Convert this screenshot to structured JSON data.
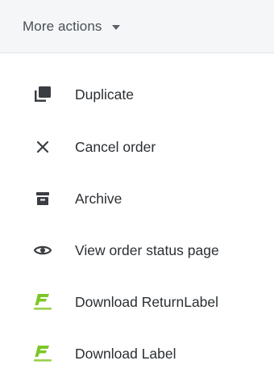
{
  "trigger": {
    "label": "More actions",
    "icon": "chevron-down-icon"
  },
  "menu": {
    "items": [
      {
        "label": "Duplicate",
        "icon": "duplicate-icon"
      },
      {
        "label": "Cancel order",
        "icon": "close-icon"
      },
      {
        "label": "Archive",
        "icon": "archive-icon"
      },
      {
        "label": "View order status page",
        "icon": "eye-icon"
      },
      {
        "label": "Download ReturnLabel",
        "icon": "app-logo-icon"
      },
      {
        "label": "Download Label",
        "icon": "app-logo-icon"
      }
    ]
  },
  "colors": {
    "trigger_bg": "#f4f6f8",
    "text": "#2b2f33",
    "icon": "#3a3d42",
    "brand_green": "#7cc728"
  }
}
